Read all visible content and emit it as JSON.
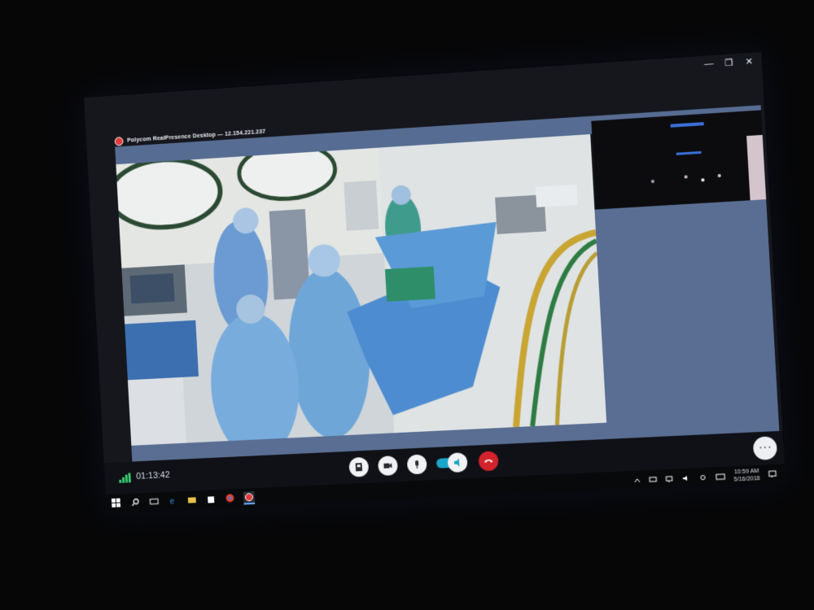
{
  "window": {
    "title": "Polycom RealPresence Desktop — 12.154.221.237",
    "controls": [
      "minimize",
      "maximize",
      "close"
    ]
  },
  "call": {
    "duration": "01:13:42"
  },
  "controls": {
    "buttons": [
      "content-share",
      "camera",
      "microphone",
      "speaker",
      "hang-up"
    ],
    "more_label": "···"
  },
  "taskbar": {
    "time": "10:59 AM",
    "date": "5/16/2018"
  },
  "colors": {
    "accent_blue": "#576c92",
    "hangup_red": "#d3232c",
    "signal_green": "#38c76d",
    "speaker_toggle": "#1aa5c9"
  }
}
